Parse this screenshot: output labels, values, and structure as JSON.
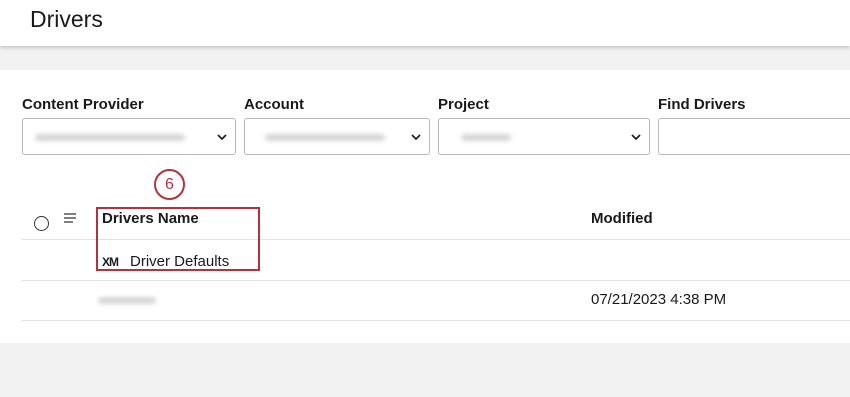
{
  "header": {
    "title": "Drivers"
  },
  "filters": {
    "content_provider": {
      "label": "Content Provider"
    },
    "account": {
      "label": "Account"
    },
    "project": {
      "label": "Project"
    },
    "find_drivers": {
      "label": "Find Drivers",
      "placeholder": ""
    }
  },
  "table": {
    "columns": {
      "name": "Drivers Name",
      "modified": "Modified"
    },
    "rows": [
      {
        "icon": "xm-icon",
        "icon_text": "XM",
        "name": "Driver Defaults",
        "modified": ""
      },
      {
        "name": "",
        "modified": "07/21/2023 4:38 PM"
      }
    ]
  },
  "annotation": {
    "step": "6",
    "color": "#b3323e"
  }
}
